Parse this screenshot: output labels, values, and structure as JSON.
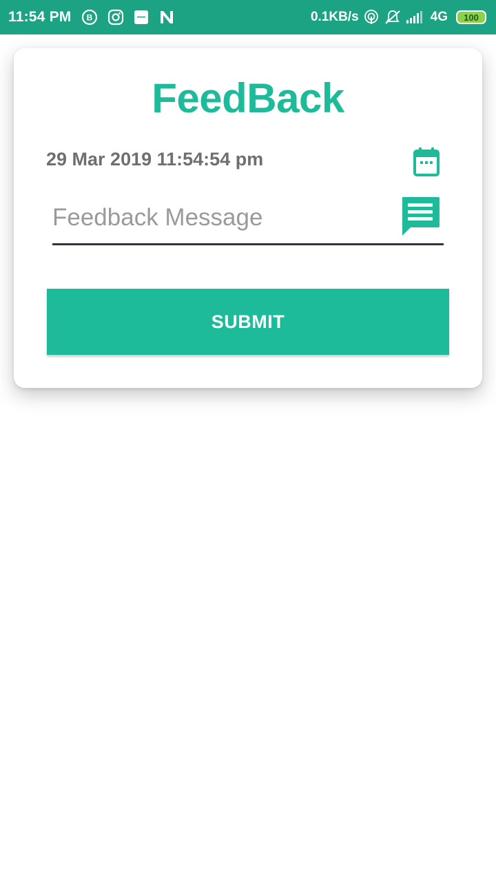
{
  "status_bar": {
    "time": "11:54 PM",
    "net_speed": "0.1KB/s",
    "network_type": "4G",
    "battery_level": "100",
    "icons": [
      "b-icon",
      "instagram-icon",
      "notification-app-icon",
      "n-icon",
      "hotspot-icon",
      "vibrate-off-icon",
      "signal-icon"
    ]
  },
  "feedback": {
    "title": "FeedBack",
    "datetime": "29 Mar 2019 11:54:54 pm",
    "message_placeholder": "Feedback Message",
    "message_value": "",
    "submit_label": "SUBMIT"
  },
  "colors": {
    "status_bar": "#1ba383",
    "accent": "#1dbb99",
    "date_text": "#6f6f6f",
    "underline": "#2c3440",
    "battery_fill": "#8bd24a"
  }
}
